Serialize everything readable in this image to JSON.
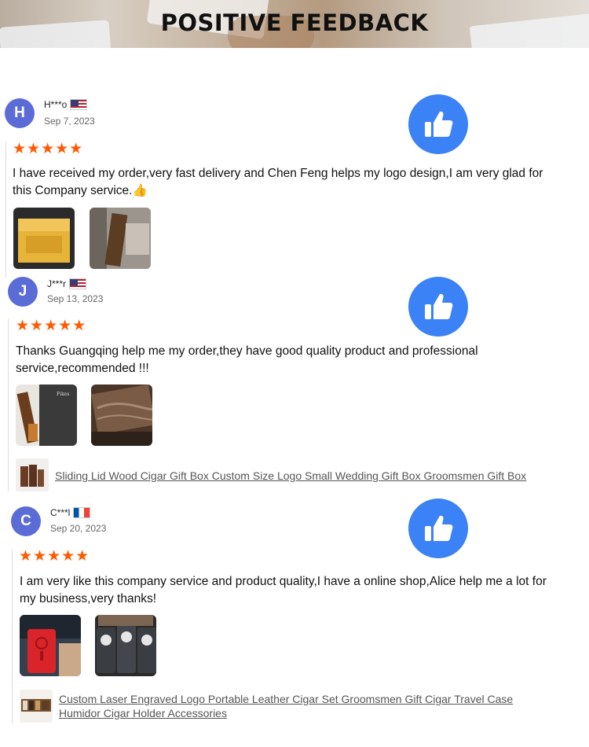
{
  "header": {
    "title": "POSITIVE FEEDBACK"
  },
  "colors": {
    "accent": "#3b82f6",
    "stars": "#ff5a00",
    "avatar": "#5b6cd6"
  },
  "reviews": [
    {
      "initial": "H",
      "name": "H***o",
      "flag": "us",
      "date": "Sep 7, 2023",
      "stars": "★★★★★",
      "rating": 5,
      "text": "I have received my order,very fast delivery and Chen Feng helps my logo design,I am very glad for this Company service.👍",
      "photos": [
        "yellow-box-photo",
        "wooden-box-photo"
      ]
    },
    {
      "initial": "J",
      "name": "J***r",
      "flag": "us",
      "date": "Sep 13, 2023",
      "stars": "★★★★★",
      "rating": 5,
      "text": "Thanks Guangqing help me my order,they have good quality product and professional service,recommended !!!",
      "photos": [
        "engraved-box-photo",
        "wood-grain-photo"
      ],
      "product": "Sliding Lid Wood Cigar Gift Box Custom Size Logo Small Wedding Gift Box Groomsmen Gift Box"
    },
    {
      "initial": "C",
      "name": "C***l",
      "flag": "fr",
      "date": "Sep 20, 2023",
      "stars": "★★★★★",
      "rating": 5,
      "text": "I am very like this company service and product quality,I have a online shop,Alice help me a lot for my business,very thanks!",
      "photos": [
        "red-cigar-case-photo",
        "leather-cases-photo"
      ],
      "product": "Custom Laser Engraved Logo Portable Leather Cigar Set Groomsmen Gift Cigar Travel Case Humidor Cigar Holder Accessories"
    }
  ]
}
